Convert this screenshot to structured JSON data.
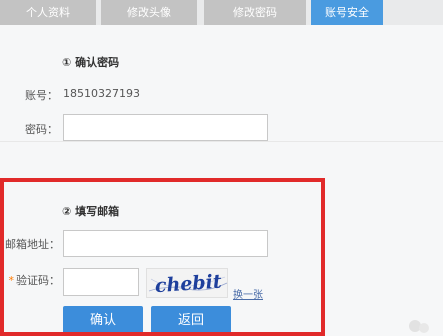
{
  "tabs": [
    {
      "label": "个人资料"
    },
    {
      "label": "修改头像"
    },
    {
      "label": "修改密码"
    },
    {
      "label": "账号安全"
    }
  ],
  "step1": {
    "title": "① 确认密码",
    "account_label": "账号：",
    "account_value": "18510327193",
    "password_label": "密码：",
    "password_value": ""
  },
  "step2": {
    "title": "② 填写邮箱",
    "email_label": "邮箱地址：",
    "email_value": "",
    "code_required_mark": "*",
    "code_label": "验证码：",
    "code_value": "",
    "captcha_text": "chebit",
    "refresh_link": "换一张"
  },
  "buttons": {
    "confirm": "确认",
    "back": "返回"
  },
  "colors": {
    "active_tab": "#4a9be0",
    "inactive_tab": "#c3c3c3",
    "button": "#3c8ddb",
    "highlight": "#e12a2a",
    "captcha_ink": "#1e3f9c"
  }
}
